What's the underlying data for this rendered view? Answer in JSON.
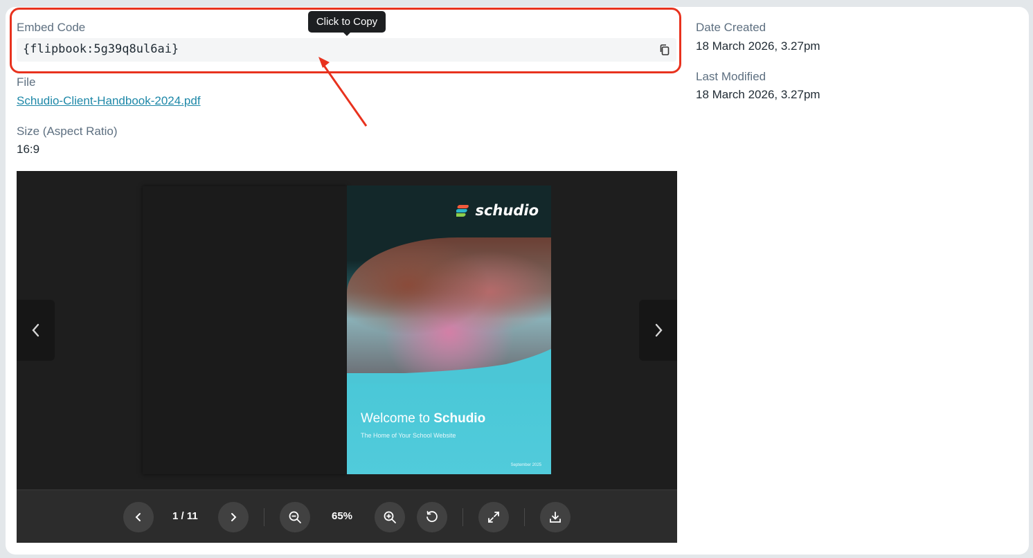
{
  "details": {
    "embed_label": "Embed Code",
    "embed_code": "{flipbook:5g39q8ul6ai}",
    "tooltip": "Click to Copy",
    "file_label": "File",
    "file_name": "Schudio-Client-Handbook-2024.pdf",
    "size_label": "Size (Aspect Ratio)",
    "size_value": "16:9",
    "date_created_label": "Date Created",
    "date_created": "18 March 2026, 3.27pm",
    "last_modified_label": "Last Modified",
    "last_modified": "18 March 2026, 3.27pm"
  },
  "viewer": {
    "cover": {
      "brand": "schudio",
      "welcome_prefix": "Welcome to ",
      "welcome_brand": "Schudio",
      "tagline": "The Home of Your School Website",
      "date": "September 2025"
    },
    "page_indicator": "1 / 11",
    "zoom": "65%"
  },
  "colors": {
    "highlight": "#e8321e",
    "link": "#1e88a8",
    "viewer_bg": "#1b1b1b",
    "toolbar_bg": "#2c2c2c"
  },
  "icons": [
    "copy-icon",
    "chevron-left-icon",
    "chevron-right-icon",
    "zoom-out-icon",
    "zoom-in-icon",
    "rotate-icon",
    "fullscreen-icon",
    "download-icon"
  ]
}
